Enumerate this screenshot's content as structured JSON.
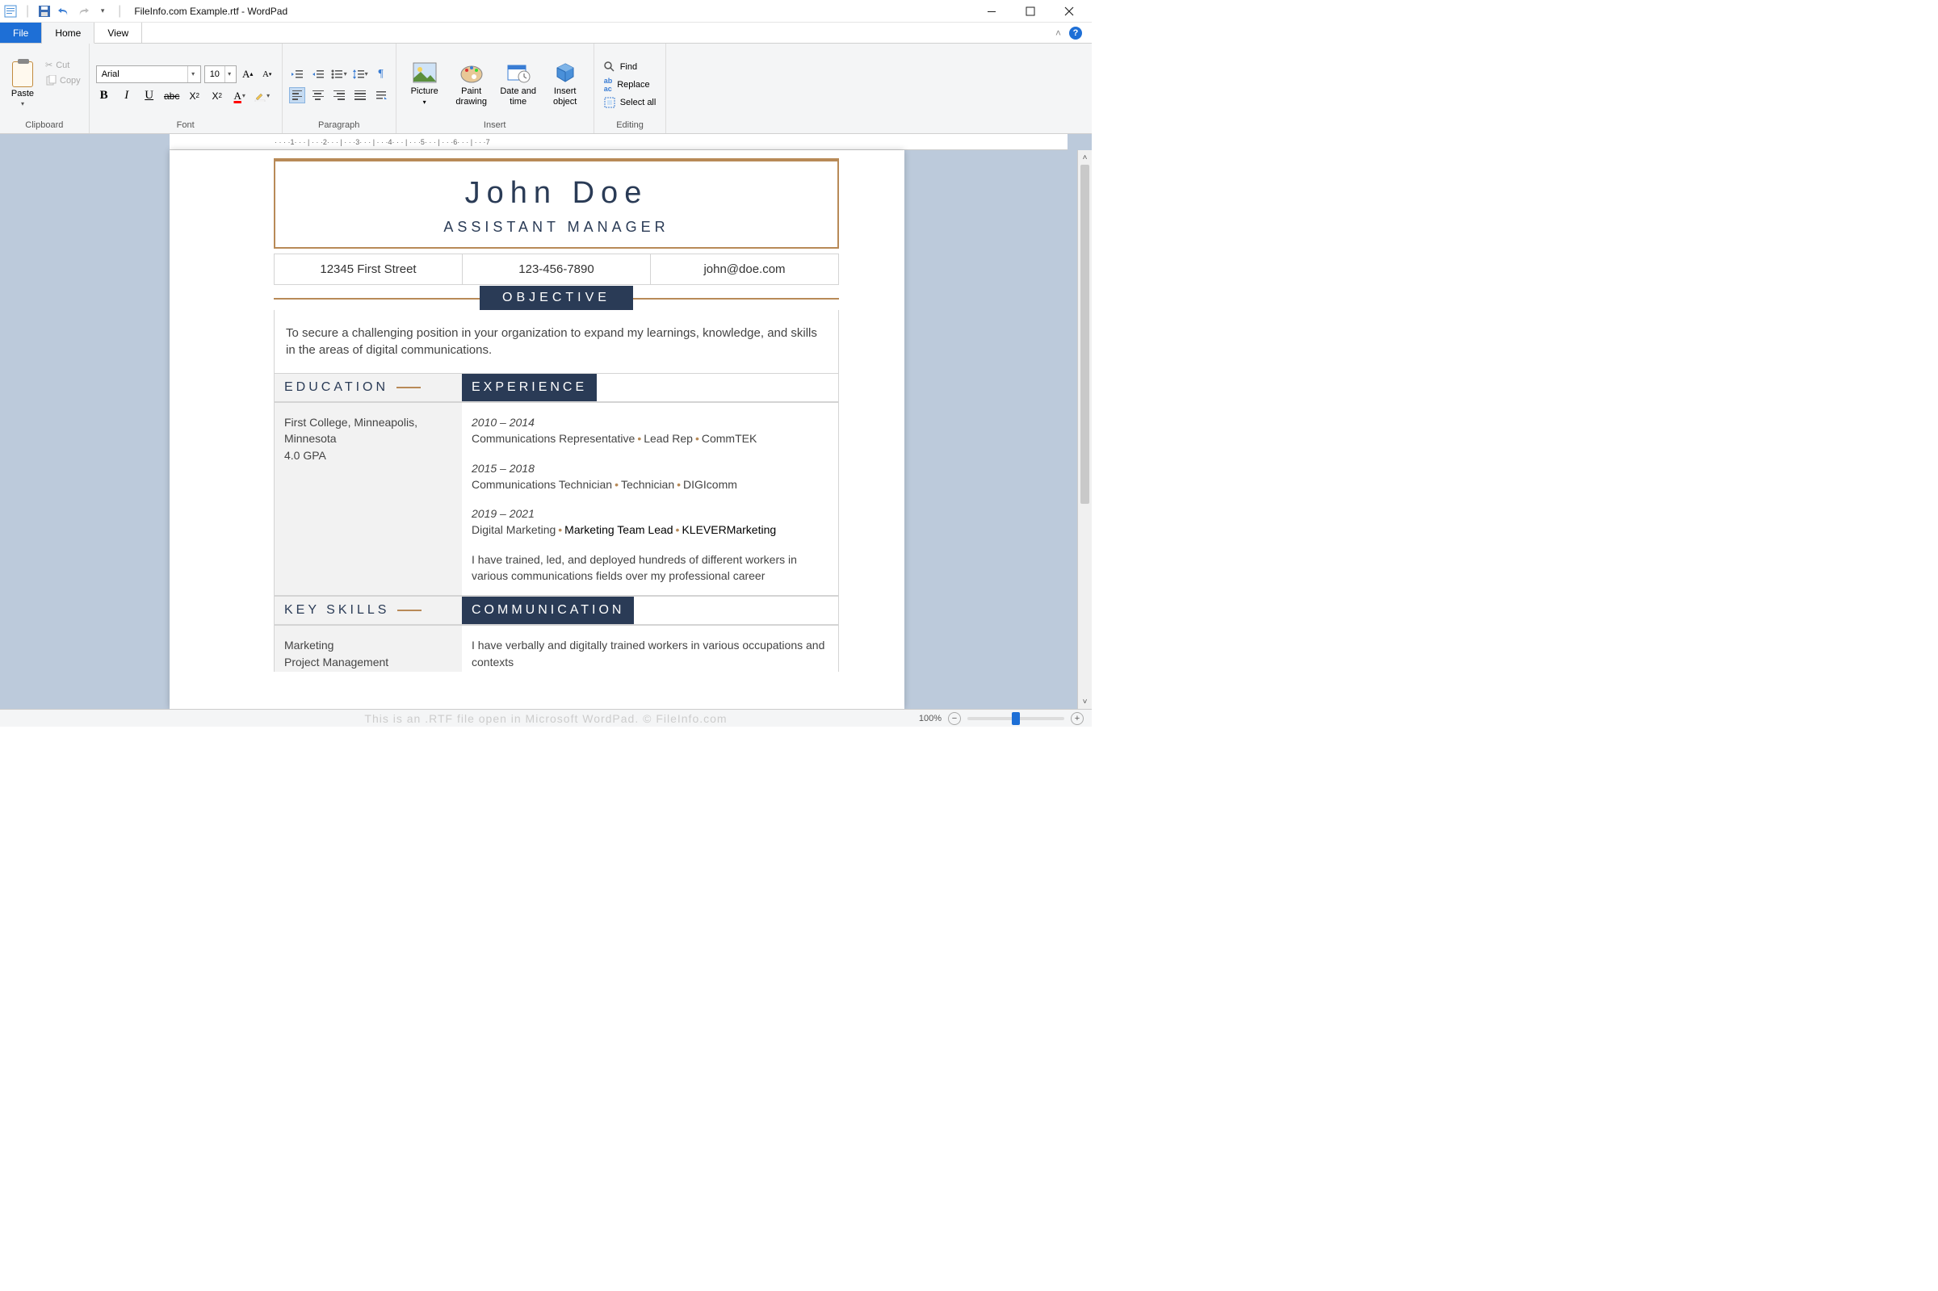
{
  "window": {
    "title": "FileInfo.com Example.rtf - WordPad",
    "watermark": "This is an .RTF file open in Microsoft WordPad. © FileInfo.com"
  },
  "tabs": {
    "file": "File",
    "home": "Home",
    "view": "View"
  },
  "ribbon": {
    "clipboard": {
      "label": "Clipboard",
      "paste": "Paste",
      "cut": "Cut",
      "copy": "Copy"
    },
    "font": {
      "label": "Font",
      "family": "Arial",
      "size": "10"
    },
    "paragraph": {
      "label": "Paragraph"
    },
    "insert": {
      "label": "Insert",
      "picture": "Picture",
      "paint": "Paint drawing",
      "datetime": "Date and time",
      "object": "Insert object"
    },
    "editing": {
      "label": "Editing",
      "find": "Find",
      "replace": "Replace",
      "selectall": "Select all"
    }
  },
  "ruler": [
    "1",
    "2",
    "3",
    "4",
    "5",
    "6",
    "7"
  ],
  "resume": {
    "name": "John Doe",
    "title": "ASSISTANT MANAGER",
    "address": "12345 First Street",
    "phone": "123-456-7890",
    "email": "john@doe.com",
    "objective_label": "OBJECTIVE",
    "objective": "To secure a challenging position in your organization to expand my learnings, knowledge, and skills in the areas of digital communications.",
    "education_label": "EDUCATION",
    "experience_label": "EXPERIENCE",
    "keyskills_label": "KEY SKILLS",
    "communication_label": "COMMUNICATION",
    "education_text1": "First College, Minneapolis, Minnesota",
    "education_text2": "4.0 GPA",
    "exp1_date": "2010 – 2014",
    "exp1_line": "Communications Representative",
    "exp1_b": "Lead Rep",
    "exp1_c": "CommTEK",
    "exp2_date": "2015 – 2018",
    "exp2_line": "Communications Technician",
    "exp2_b": "Technician",
    "exp2_c": "DIGIcomm",
    "exp3_date": "2019 – 2021",
    "exp3_line": "Digital Marketing",
    "exp3_b": "Marketing Team Lead",
    "exp3_c": "KLEVERMarketing",
    "exp_summary": "I have trained, led, and deployed hundreds of different workers in various communications fields over my professional career",
    "skills1": "Marketing",
    "skills2": "Project Management",
    "comm_text": "I have verbally and digitally trained workers in various occupations and contexts"
  },
  "status": {
    "zoom": "100%"
  }
}
